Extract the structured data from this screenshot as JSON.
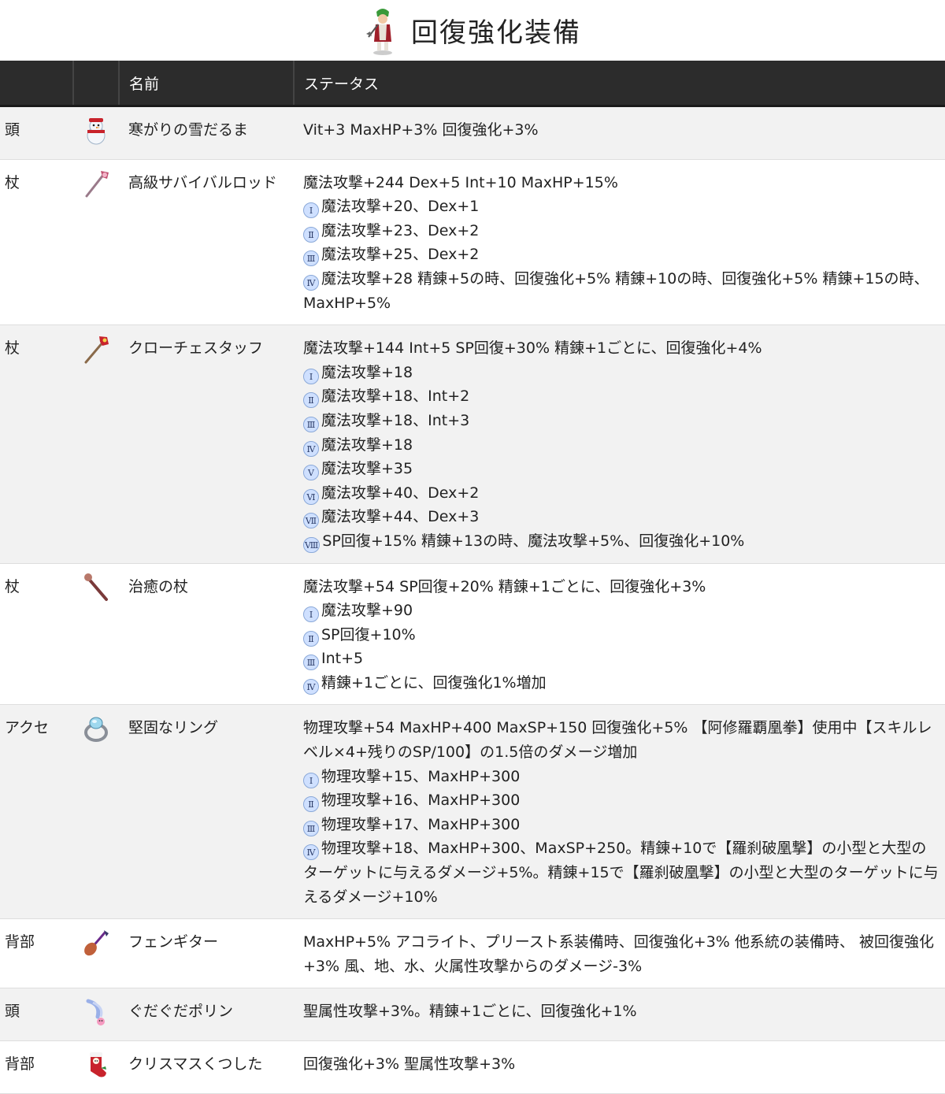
{
  "page": {
    "title": "回復強化装備",
    "header_icon": "acolyte-character-icon"
  },
  "table": {
    "headers": [
      "",
      "",
      "名前",
      "ステータス"
    ],
    "rows": [
      {
        "slot": "頭",
        "icon": "snowman-hat-icon",
        "name": "寒がりの雪だるま",
        "status": [
          {
            "badge": "",
            "text": "Vit+3 MaxHP+3% 回復強化+3%"
          }
        ]
      },
      {
        "slot": "杖",
        "icon": "survival-rod-icon",
        "name": "高級サバイバルロッド",
        "status": [
          {
            "badge": "",
            "text": "魔法攻撃+244 Dex+5 Int+10 MaxHP+15%"
          },
          {
            "badge": "Ⅰ",
            "text": "魔法攻撃+20、Dex+1"
          },
          {
            "badge": "Ⅱ",
            "text": "魔法攻撃+23、Dex+2"
          },
          {
            "badge": "Ⅲ",
            "text": "魔法攻撃+25、Dex+2"
          },
          {
            "badge": "Ⅳ",
            "text": "魔法攻撃+28 精錬+5の時、回復強化+5% 精錬+10の時、回復強化+5% 精錬+15の時、MaxHP+5%"
          }
        ]
      },
      {
        "slot": "杖",
        "icon": "crozier-staff-icon",
        "name": "クローチェスタッフ",
        "status": [
          {
            "badge": "",
            "text": "魔法攻撃+144 Int+5 SP回復+30% 精錬+1ごとに、回復強化+4%"
          },
          {
            "badge": "Ⅰ",
            "text": "魔法攻撃+18"
          },
          {
            "badge": "Ⅱ",
            "text": "魔法攻撃+18、Int+2"
          },
          {
            "badge": "Ⅲ",
            "text": "魔法攻撃+18、Int+3"
          },
          {
            "badge": "Ⅳ",
            "text": "魔法攻撃+18"
          },
          {
            "badge": "Ⅴ",
            "text": "魔法攻撃+35"
          },
          {
            "badge": "Ⅵ",
            "text": "魔法攻撃+40、Dex+2"
          },
          {
            "badge": "Ⅶ",
            "text": "魔法攻撃+44、Dex+3"
          },
          {
            "badge": "Ⅷ",
            "text": "SP回復+15% 精錬+13の時、魔法攻撃+5%、回復強化+10%"
          }
        ]
      },
      {
        "slot": "杖",
        "icon": "healing-staff-icon",
        "name": "治癒の杖",
        "status": [
          {
            "badge": "",
            "text": "魔法攻撃+54 SP回復+20% 精錬+1ごとに、回復強化+3%"
          },
          {
            "badge": "Ⅰ",
            "text": "魔法攻撃+90"
          },
          {
            "badge": "Ⅱ",
            "text": "SP回復+10%"
          },
          {
            "badge": "Ⅲ",
            "text": "Int+5"
          },
          {
            "badge": "Ⅳ",
            "text": "精錬+1ごとに、回復強化1%増加"
          }
        ]
      },
      {
        "slot": "アクセ",
        "icon": "ring-icon",
        "name": "堅固なリング",
        "status": [
          {
            "badge": "",
            "text": "物理攻撃+54 MaxHP+400 MaxSP+150 回復強化+5% 【阿修羅覇凰拳】使用中【スキルレベル×4+残りのSP/100】の1.5倍のダメージ増加"
          },
          {
            "badge": "Ⅰ",
            "text": "物理攻撃+15、MaxHP+300"
          },
          {
            "badge": "Ⅱ",
            "text": "物理攻撃+16、MaxHP+300"
          },
          {
            "badge": "Ⅲ",
            "text": "物理攻撃+17、MaxHP+300"
          },
          {
            "badge": "Ⅳ",
            "text": "物理攻撃+18、MaxHP+300、MaxSP+250。精錬+10で【羅刹破凰撃】の小型と大型のターゲットに与えるダメージ+5%。精錬+15で【羅刹破凰撃】の小型と大型のターゲットに与えるダメージ+10%"
          }
        ]
      },
      {
        "slot": "背部",
        "icon": "fen-guitar-icon",
        "name": "フェンギター",
        "status": [
          {
            "badge": "",
            "text": "MaxHP+5% アコライト、プリースト系装備時、回復強化+3% 他系統の装備時、 被回復強化+3% 風、地、水、火属性攻撃からのダメージ-3%"
          }
        ]
      },
      {
        "slot": "頭",
        "icon": "poring-feather-icon",
        "name": "ぐだぐだポリン",
        "status": [
          {
            "badge": "",
            "text": "聖属性攻撃+3%。精錬+1ごとに、回復強化+1%"
          }
        ]
      },
      {
        "slot": "背部",
        "icon": "christmas-stocking-icon",
        "name": "クリスマスくつした",
        "status": [
          {
            "badge": "",
            "text": "回復強化+3% 聖属性攻撃+3%"
          }
        ]
      }
    ]
  }
}
